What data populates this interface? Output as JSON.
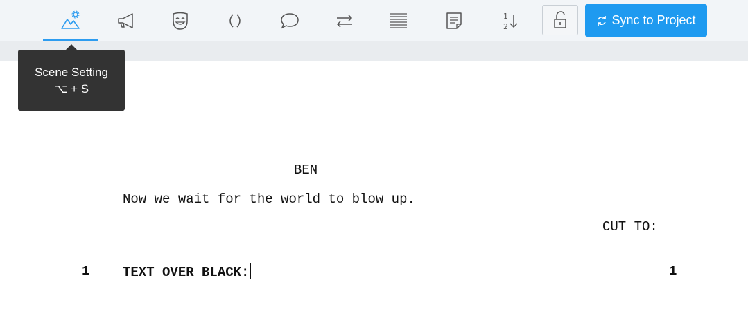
{
  "toolbar": {
    "tools": [
      {
        "icon": "scene-setting-icon"
      },
      {
        "icon": "megaphone-icon"
      },
      {
        "icon": "theater-mask-icon"
      },
      {
        "icon": "parenthetical-icon"
      },
      {
        "icon": "speech-bubble-icon"
      },
      {
        "icon": "transition-arrows-icon"
      },
      {
        "icon": "lines-icon"
      },
      {
        "icon": "note-icon"
      },
      {
        "icon": "scene-numbering-icon"
      }
    ],
    "active_tool": "scene-setting",
    "sync_label": "Sync to Project",
    "accent_color": "#1e9af0"
  },
  "tooltip": {
    "title": "Scene Setting",
    "shortcut": "⌥ + S"
  },
  "script": {
    "character": "BEN",
    "dialogue": "Now we wait for the world to blow up.",
    "transition": "CUT TO:",
    "scene_heading": "TEXT OVER BLACK:",
    "scene_number_left": "1",
    "scene_number_right": "1"
  }
}
